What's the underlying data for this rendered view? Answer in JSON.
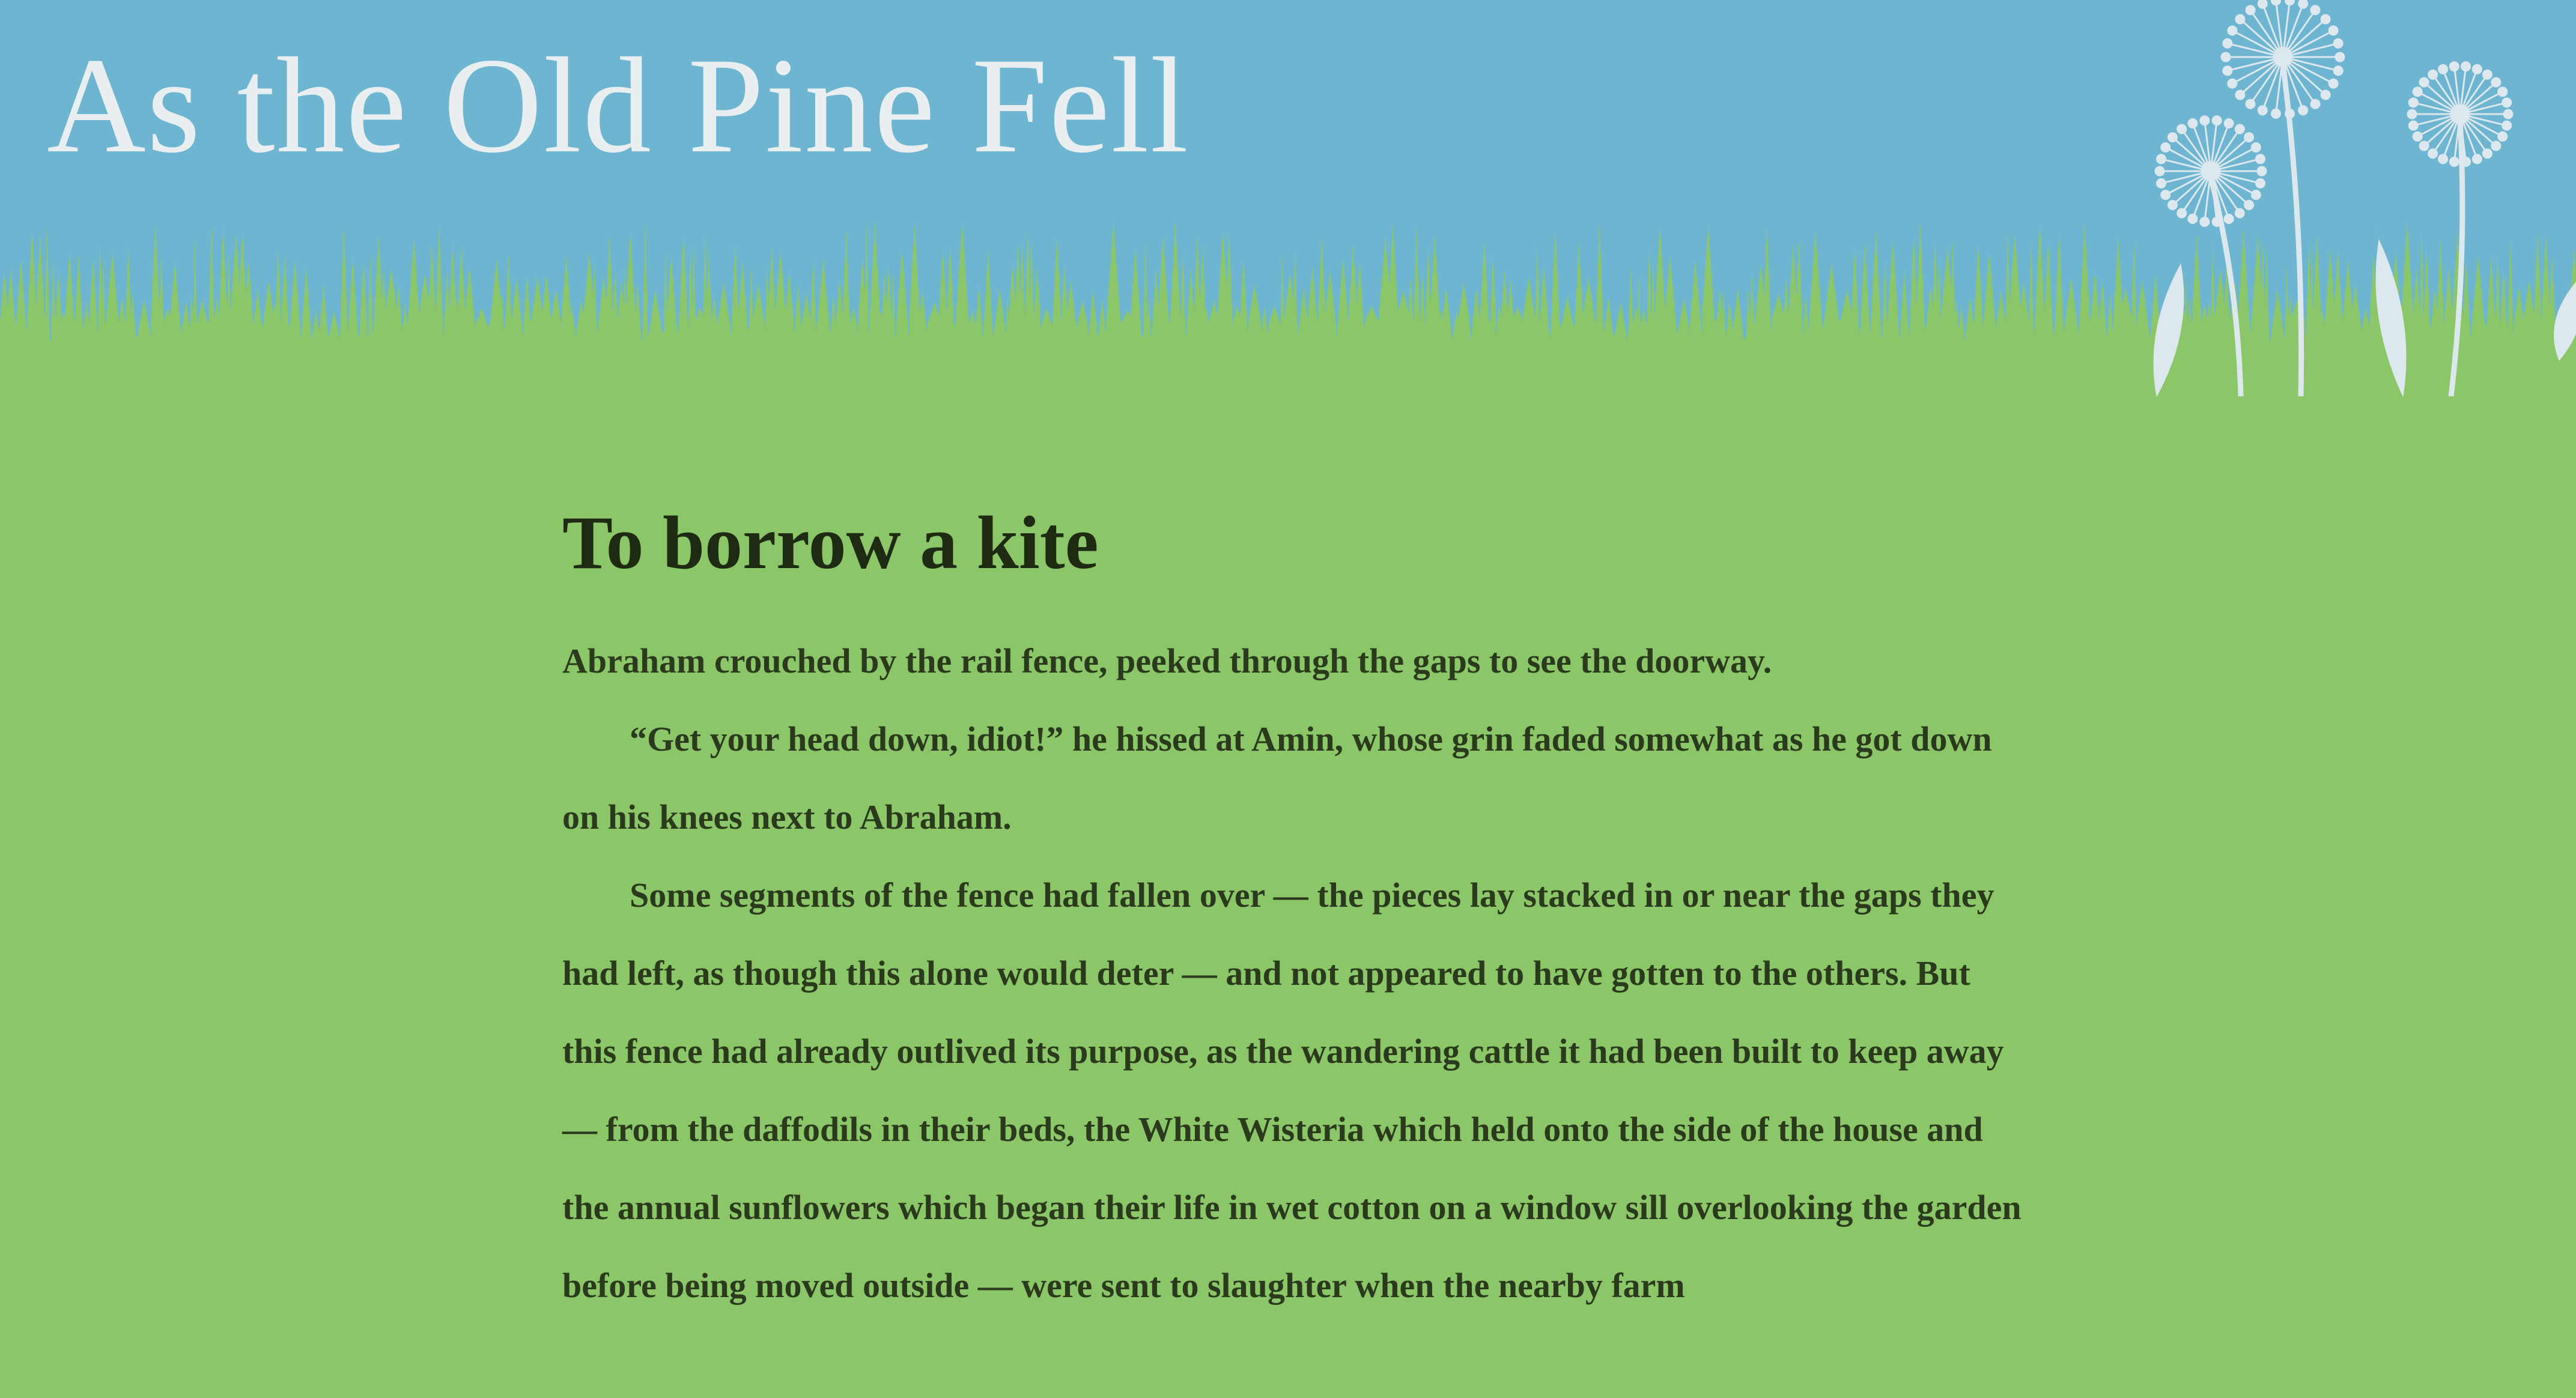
{
  "header": {
    "site_title": "As the Old Pine Fell",
    "colors": {
      "sky": "#6db5d0",
      "grass": "#8bc769",
      "title_text": "#e9eef0",
      "dandelion": "#dde8ee"
    },
    "decoration_icons": [
      "dandelion-icon",
      "grass-blades-icon"
    ]
  },
  "post": {
    "title": "To borrow a kite",
    "paragraphs": [
      "Abraham crouched by the rail fence, peeked through the gaps to see the doorway.",
      "“Get your head down, idiot!” he hissed at Amin, whose grin faded somewhat as he got down on his knees next to Abraham.",
      "Some segments of the fence had fallen over — the pieces lay stacked in or near the gaps they had left, as though this alone would deter — and not appeared to have gotten to the others. But this fence had already outlived its purpose, as the wandering cattle it had been built to keep away — from the daffodils in their beds, the White Wisteria which held onto the side of the house and the annual sunflowers which began their life in wet cotton on a window sill overlooking the garden before being moved outside — were sent to slaughter when the nearby farm"
    ],
    "colors": {
      "title_text": "#1e2a12",
      "body_text": "#2b3a1d"
    }
  }
}
